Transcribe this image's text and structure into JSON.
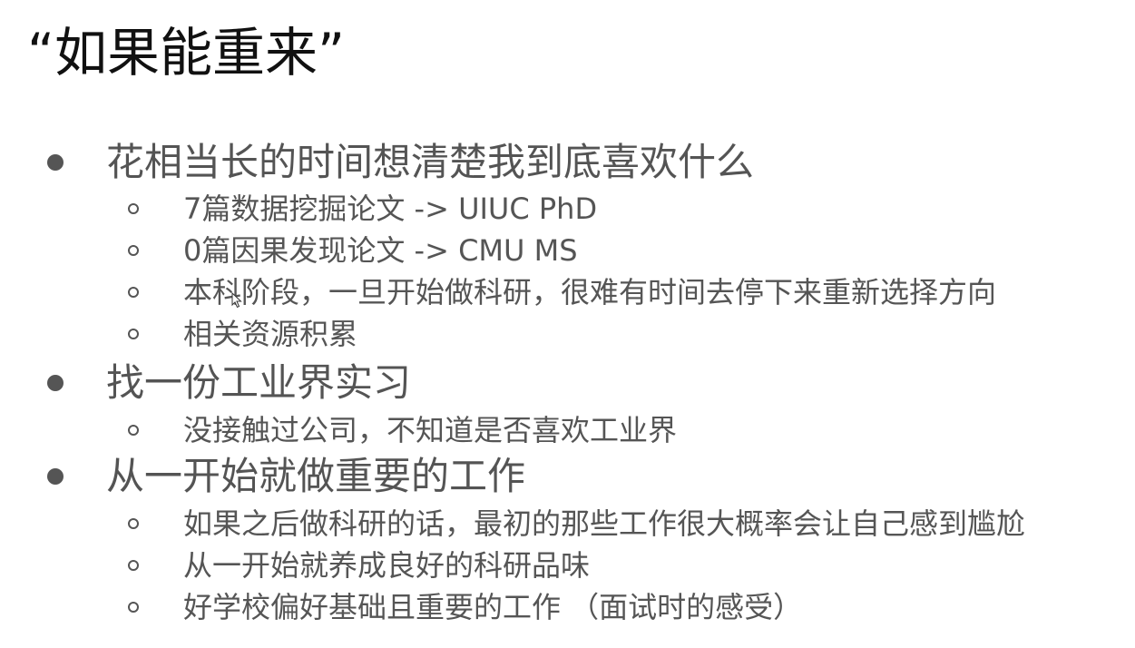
{
  "slide": {
    "title": "“如果能重来”",
    "sections": [
      {
        "text": "花相当长的时间想清楚我到底喜欢什么",
        "items": [
          "7篇数据挖掘论文 -> UIUC PhD",
          "0篇因果发现论文 -> CMU MS",
          "本科阶段，一旦开始做科研，很难有时间去停下来重新选择方向",
          "相关资源积累"
        ]
      },
      {
        "text": "找一份工业界实习",
        "items": [
          "没接触过公司，不知道是否喜欢工业界"
        ]
      },
      {
        "text": "从一开始就做重要的工作",
        "items": [
          "如果之后做科研的话，最初的那些工作很大概率会让自己感到尴尬",
          "从一开始就养成良好的科研品味",
          "好学校偏好基础且重要的工作 （面试时的感受）"
        ]
      }
    ]
  },
  "colors": {
    "background": "#ffffff",
    "title": "#111111",
    "body_text": "#545454",
    "bullet": "#555555"
  },
  "icons": {
    "level1_bullet": "filled-circle",
    "level2_bullet": "hollow-circle",
    "cursor": "mouse-pointer-icon"
  }
}
